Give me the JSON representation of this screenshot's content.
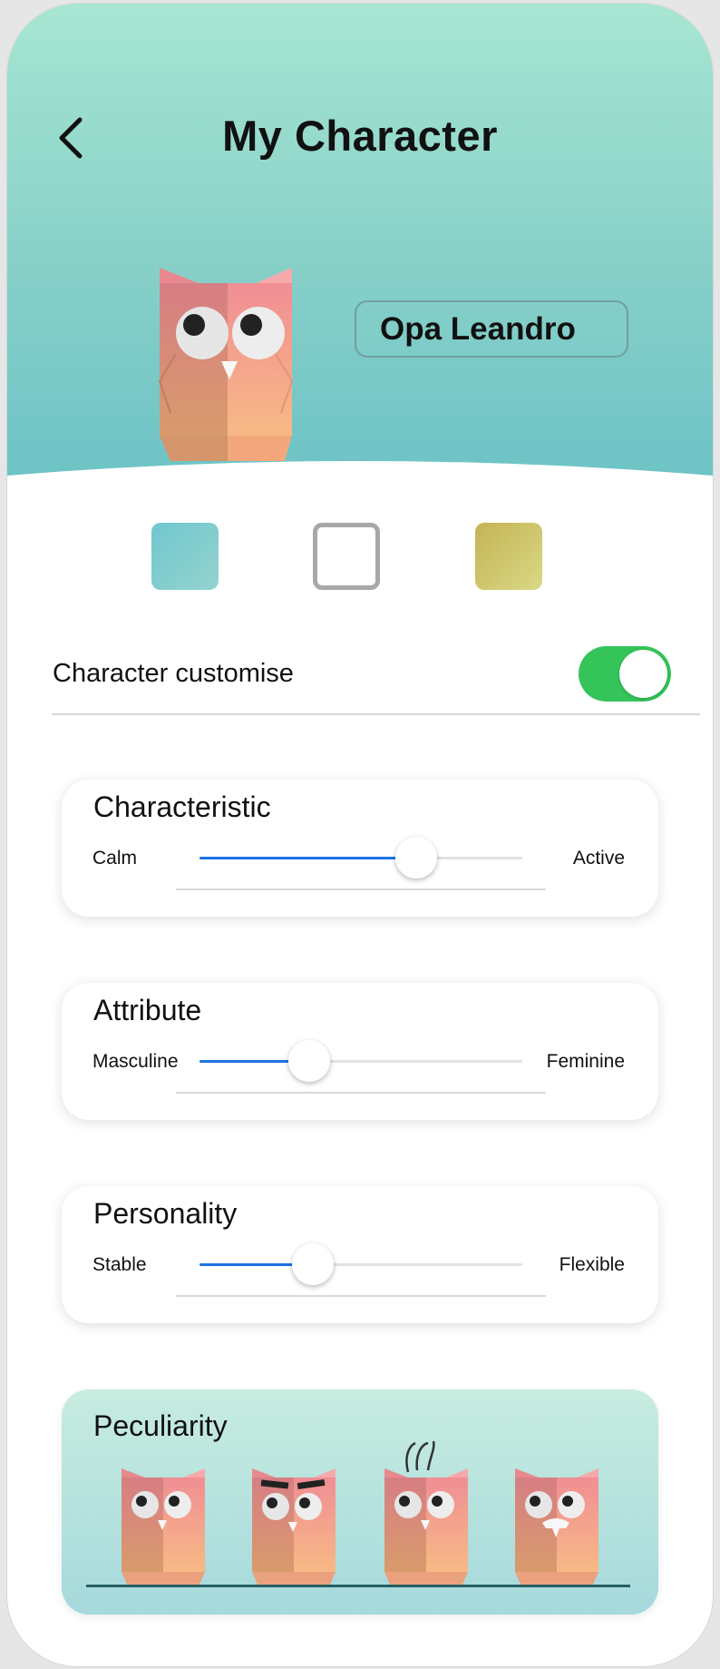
{
  "header": {
    "title": "My Character",
    "back_icon": "chevron-left-icon"
  },
  "character": {
    "name": "Opa Leandro"
  },
  "colors": {
    "header_top": "#a7e6d2",
    "header_bottom": "#6ec3c6",
    "toggle_on": "#35c459",
    "slider_fill": "#1b74e4"
  },
  "swatches": [
    {
      "name": "teal-swatch",
      "color": "#6fc7cf"
    },
    {
      "name": "empty-swatch",
      "color": "#ffffff"
    },
    {
      "name": "olive-swatch",
      "color": "#c4b355"
    }
  ],
  "customise": {
    "label": "Character customise",
    "enabled": true
  },
  "sliders": [
    {
      "title": "Characteristic",
      "left": "Calm",
      "right": "Active",
      "value": 0.67
    },
    {
      "title": "Attribute",
      "left": "Masculine",
      "right": "Feminine",
      "value": 0.34
    },
    {
      "title": "Personality",
      "left": "Stable",
      "right": "Flexible",
      "value": 0.35
    }
  ],
  "peculiarity": {
    "title": "Peculiarity",
    "variants": [
      "plain",
      "eyebrows",
      "hair",
      "teeth"
    ]
  }
}
